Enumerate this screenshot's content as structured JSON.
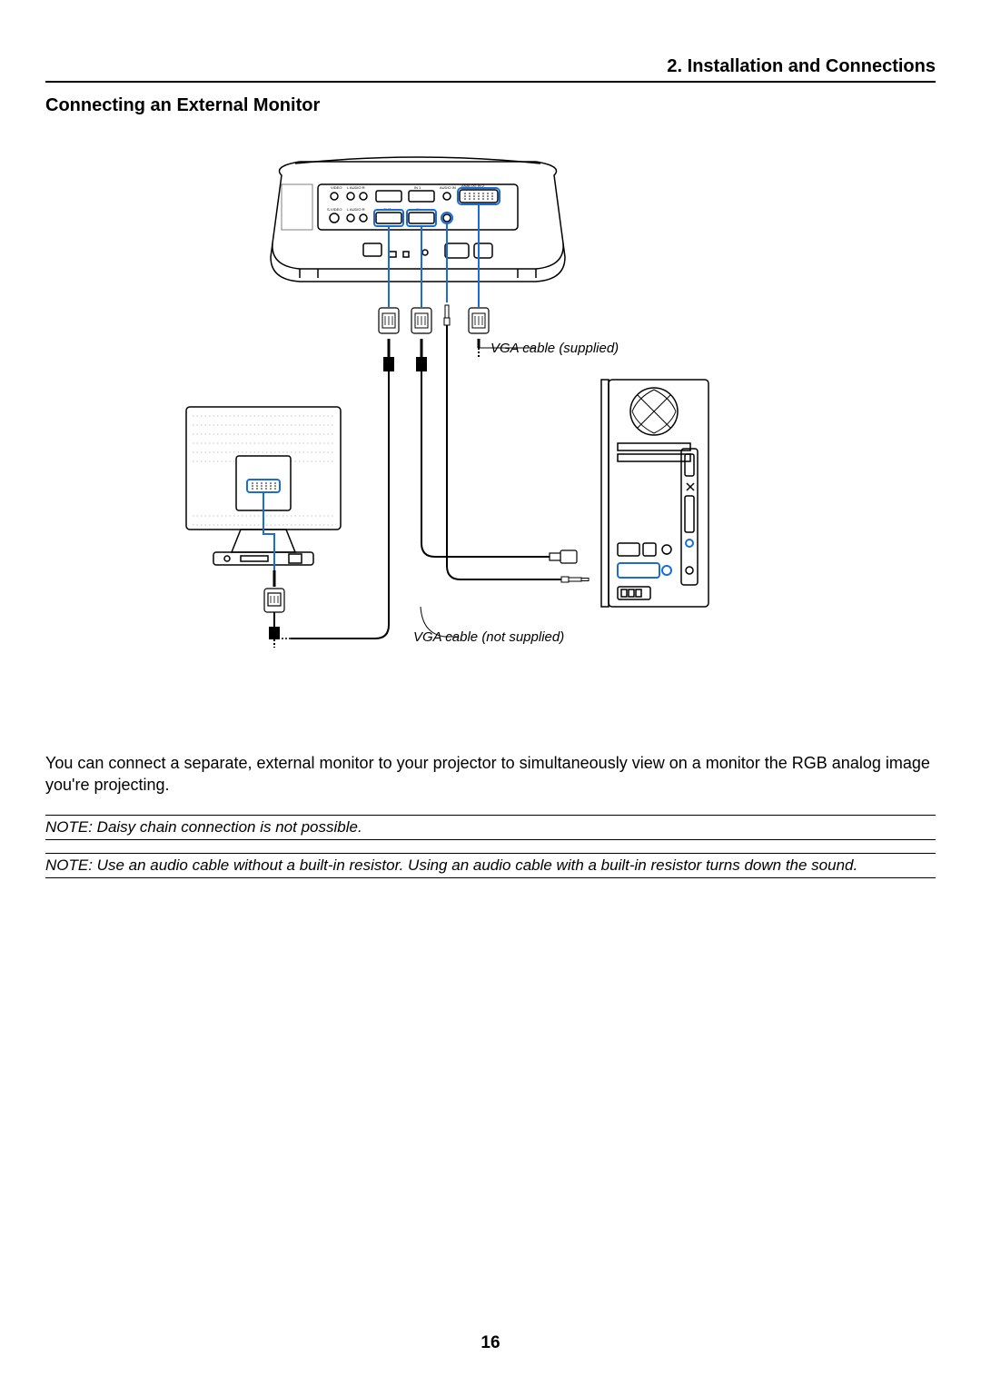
{
  "header": {
    "chapter": "2. Installation and Connections"
  },
  "subheading": "Connecting an External Monitor",
  "diagram": {
    "label_vga_supplied": "VGA cable (supplied)",
    "label_vga_not_supplied": "VGA cable (not supplied)",
    "port_labels": {
      "video": "VIDEO",
      "audio_in_top": "L AUDIO R",
      "s_video": "S-VIDEO",
      "audio_in_bottom": "L AUDIO R",
      "out": "OUT",
      "in1": "IN 1",
      "audio_in": "AUDIO IN",
      "analog_in_2": "ANALOG IN 2",
      "in": "IN"
    }
  },
  "body_paragraph": "You can connect a separate, external monitor to your projector to simultaneously view on a monitor the RGB analog image you're projecting.",
  "notes": [
    "NOTE: Daisy chain connection is not possible.",
    "NOTE: Use an audio cable without a built-in resistor. Using an audio cable with a built-in resistor turns down the sound."
  ],
  "page_number": "16"
}
